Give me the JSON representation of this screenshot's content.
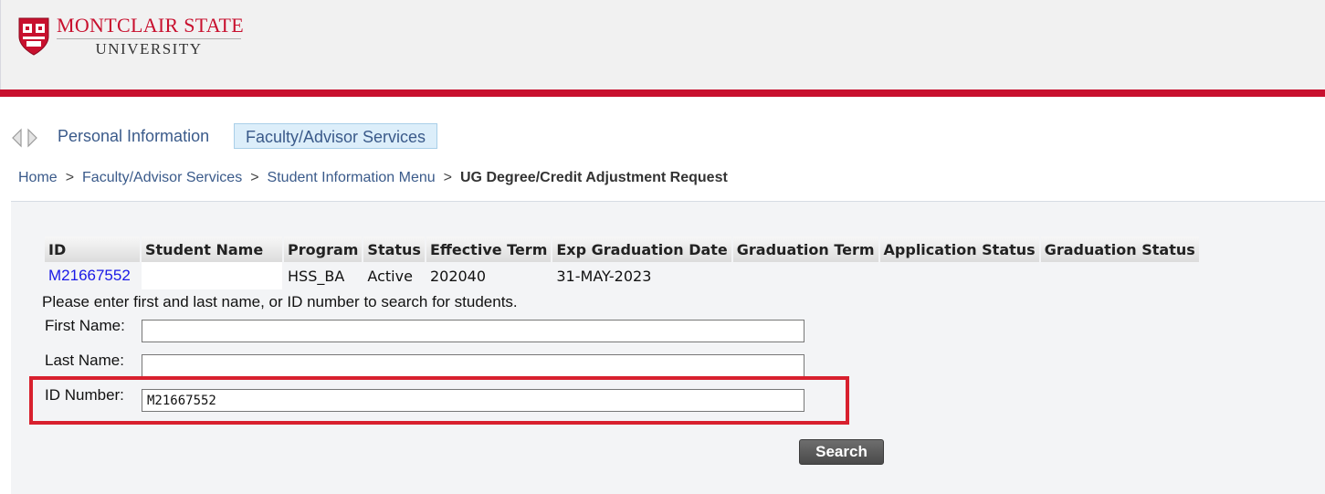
{
  "header": {
    "university_name_line1": "MONTCLAIR STATE",
    "university_name_line2": "UNIVERSITY",
    "brand_color": "#c8102e"
  },
  "nav": {
    "arrows_icon": "back-forward-arrows-icon",
    "tabs": [
      {
        "label": "Personal Information",
        "active": false
      },
      {
        "label": "Faculty/Advisor Services",
        "active": true
      }
    ]
  },
  "breadcrumb": {
    "items": [
      "Home",
      "Faculty/Advisor Services",
      "Student Information Menu"
    ],
    "current": "UG Degree/Credit Adjustment Request",
    "separator": ">"
  },
  "results_table": {
    "columns": [
      "ID",
      "Student Name",
      "Program",
      "Status",
      "Effective Term",
      "Exp Graduation Date",
      "Graduation Term",
      "Application Status",
      "Graduation Status"
    ],
    "rows": [
      {
        "id": "M21667552",
        "student_name": "",
        "program": "HSS_BA",
        "status": "Active",
        "effective_term": "202040",
        "exp_graduation_date": "31-MAY-2023",
        "graduation_term": "",
        "application_status": "",
        "graduation_status": ""
      }
    ]
  },
  "search_form": {
    "instruction": "Please enter first and last name, or ID number to search for students.",
    "first_name_label": "First Name:",
    "first_name_value": "",
    "last_name_label": "Last Name:",
    "last_name_value": "",
    "id_number_label": "ID Number:",
    "id_number_value": "M21667552",
    "search_button": "Search",
    "highlight_color": "#d8202e"
  }
}
